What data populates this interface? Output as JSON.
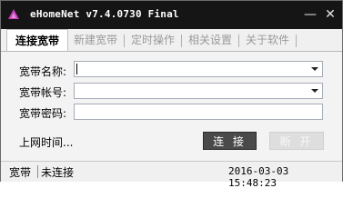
{
  "window": {
    "title": "eHomeNet v7.4.0730 Final",
    "minimize_icon": "minimize-icon",
    "close_icon": "close-icon",
    "minimize_glyph": "—",
    "close_glyph": "✕"
  },
  "tabs": [
    {
      "label": "连接宽带",
      "active": true
    },
    {
      "label": "新建宽带",
      "active": false
    },
    {
      "label": "定时操作",
      "active": false
    },
    {
      "label": "相关设置",
      "active": false
    },
    {
      "label": "关于软件",
      "active": false
    }
  ],
  "form": {
    "account_name_label": "宽带名称:",
    "account_name_value": "",
    "username_label": "宽带帐号:",
    "username_value": "",
    "password_label": "宽带密码:",
    "password_value": "",
    "online_time_label": "上网时间..."
  },
  "buttons": {
    "connect": "连 接",
    "disconnect": "断 开"
  },
  "status": {
    "type": "宽带",
    "connection": "未连接",
    "datetime": "2016-03-03 15:48:23"
  }
}
